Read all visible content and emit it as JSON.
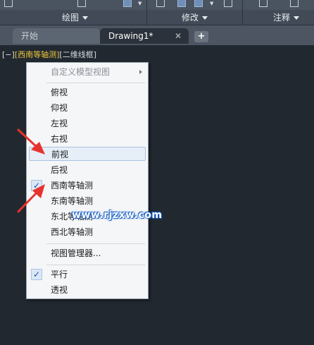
{
  "ribbon": {
    "panels": [
      {
        "label": "绘图"
      },
      {
        "label": "修改"
      },
      {
        "label": "注释"
      }
    ]
  },
  "tabs": [
    {
      "label": "开始"
    },
    {
      "label": "Drawing1*"
    }
  ],
  "tab_close_glyph": "✕",
  "tab_add_glyph": "+",
  "viewport_controls": {
    "minus": "[−]",
    "view": "[西南等轴测]",
    "style": "[二维线框]"
  },
  "menu": {
    "custom_views": "自定义模型视图",
    "views": [
      "俯视",
      "仰视",
      "左视",
      "右视",
      "前视",
      "后视",
      "西南等轴测",
      "东南等轴测",
      "东北等轴测",
      "西北等轴测"
    ],
    "view_manager": "视图管理器...",
    "projections": [
      "平行",
      "透视"
    ],
    "check_glyph": "✓"
  },
  "watermark": "www.rjzxw.com",
  "colors": {
    "annotation_arrow": "#e8322e",
    "selected_view_text": "#f0c63a",
    "watermark_outline": "#1e63c8"
  }
}
